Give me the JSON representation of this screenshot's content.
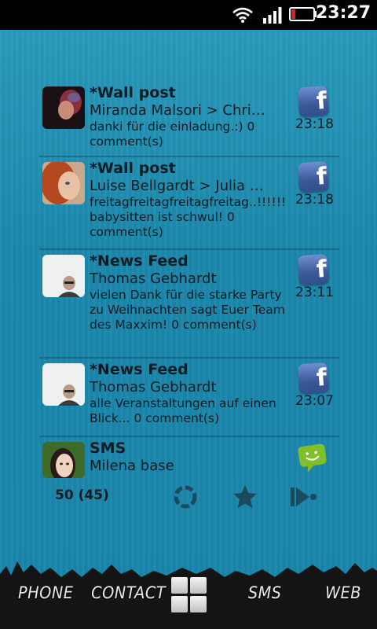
{
  "statusbar": {
    "time": "23:27"
  },
  "feed": [
    {
      "title": "*Wall post",
      "subject": "Miranda Malsori > Chri…",
      "body": "danki für die einladung.:) 0 comment(s)",
      "time": "23:18",
      "source": "facebook-icon"
    },
    {
      "title": "*Wall post",
      "subject": "Luise Bellgardt > Julia …",
      "body": "freitagfreitagfreitagfreitag..!!!!!! babysitten ist schwul! 0 comment(s)",
      "time": "23:18",
      "source": "facebook-icon"
    },
    {
      "title": "*News Feed",
      "subject": "Thomas Gebhardt",
      "body": "vielen Dank für die starke Party zu Weihnachten sagt Euer Team des Maxxim! 0 comment(s)",
      "time": "23:11",
      "source": "facebook-icon"
    },
    {
      "title": "*News Feed",
      "subject": "Thomas Gebhardt",
      "body": "alle Veranstaltungen auf einen Blick... 0 comment(s)",
      "time": "23:07",
      "source": "facebook-icon"
    },
    {
      "title": "SMS",
      "subject": "Milena base",
      "body": "",
      "time": "",
      "source": "sms-bubble-icon"
    }
  ],
  "toolbar": {
    "count": "50 (45)"
  },
  "dock": {
    "phone": "PHONE",
    "contact": "CONTACT",
    "sms": "SMS",
    "web": "WEB"
  },
  "colors": {
    "background": "#1b87ab",
    "text": "#0c1b22",
    "facebook": "#3b5998",
    "sms_green": "#7fbf2a"
  }
}
